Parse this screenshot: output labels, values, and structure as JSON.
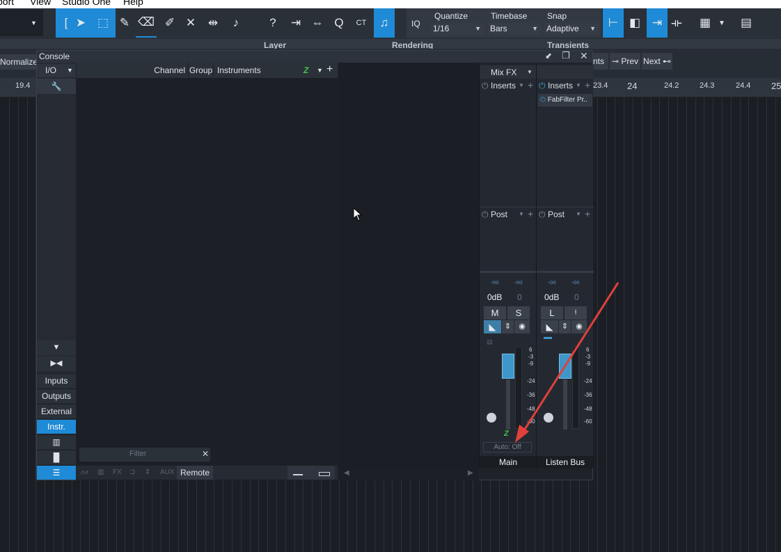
{
  "menu": [
    "port",
    "View",
    "Studio One",
    "Help"
  ],
  "toolbar": {
    "quantize_label": "Quantize",
    "quantize_value": "1/16",
    "timebase_label": "Timebase",
    "timebase_value": "Bars",
    "snap_label": "Snap",
    "snap_value": "Adaptive",
    "iq_label": "IQ",
    "tools": [
      "bracket-icon",
      "arrow-tool-icon",
      "range-tool-icon",
      "pencil-tool-icon",
      "eraser-tool-icon",
      "paint-tool-icon",
      "mute-tool-icon",
      "split-tool-icon",
      "listen-tool-icon",
      "help-icon",
      "bend-tool-icon",
      "scrub-icon",
      "zoom-icon",
      "ct-icon",
      "audio-icon"
    ],
    "accent": "#1f8ad6"
  },
  "subbar": {
    "layer": "Layer",
    "rendering": "Rendering",
    "transients": "Transients"
  },
  "editbar": {
    "normalize": "Normalize",
    "ents": "nts",
    "prev": "Prev",
    "next": "Next"
  },
  "ruler": [
    "19.4",
    "23.4",
    "24",
    "24.2",
    "24.3",
    "24.4",
    "25"
  ],
  "console": {
    "title": "Console",
    "io_label": "I/O",
    "channel_header": "Channel",
    "group_header": "Group",
    "instruments_header": "Instruments",
    "side_buttons": [
      "Inputs",
      "Outputs",
      "External",
      "Instr."
    ],
    "filter_placeholder": "Filter",
    "bottom_icons": [
      "AUX",
      "Remote"
    ],
    "fx_label": "FX",
    "mixfx_label": "Mix FX",
    "strips": [
      {
        "name": "Main",
        "inserts_label": "Inserts",
        "post_label": "Post",
        "gain": "0dB",
        "pan": "0",
        "btn1": "M",
        "btn2": "S",
        "auto": "Auto: Off",
        "insert_plugin": ""
      },
      {
        "name": "Listen Bus",
        "inserts_label": "Inserts",
        "post_label": "Post",
        "gain": "0dB",
        "pan": "0",
        "btn1": "L",
        "btn2": "",
        "insert_plugin": "FabFilter Pr.."
      }
    ],
    "meter_scale": [
      "6",
      "-3",
      "-9",
      "-24",
      "-36",
      "-48",
      "-60"
    ],
    "peak_readout": "-oo"
  }
}
